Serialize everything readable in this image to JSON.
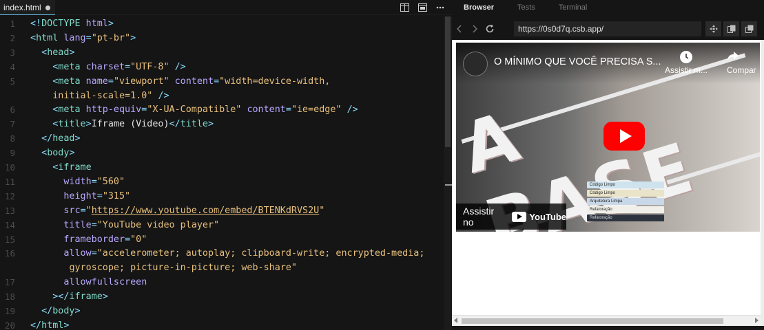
{
  "editor": {
    "tab": {
      "filename": "index.html",
      "unsaved": true
    },
    "actions": [
      "split-icon",
      "preview-icon",
      "more-icon"
    ],
    "lines": [
      {
        "n": "1",
        "html": "<span class=\"t\">&lt;!</span><span class=\"tn\">DOCTYPE</span> <span class=\"a\">html</span><span class=\"t\">&gt;</span>"
      },
      {
        "n": "2",
        "html": "<span class=\"t\">&lt;</span><span class=\"tn\">html</span> <span class=\"a\">lang</span><span class=\"t\">=</span><span class=\"v\">\"pt-br\"</span><span class=\"t\">&gt;</span>"
      },
      {
        "n": "3",
        "html": "  <span class=\"t\">&lt;</span><span class=\"tn\">head</span><span class=\"t\">&gt;</span>"
      },
      {
        "n": "4",
        "html": "    <span class=\"t\">&lt;</span><span class=\"tn\">meta</span> <span class=\"a\">charset</span><span class=\"t\">=</span><span class=\"v\">\"UTF-8\"</span> <span class=\"t\">/&gt;</span>"
      },
      {
        "n": "5",
        "html": "    <span class=\"t\">&lt;</span><span class=\"tn\">meta</span> <span class=\"a\">name</span><span class=\"t\">=</span><span class=\"v\">\"viewport\"</span> <span class=\"a\">content</span><span class=\"t\">=</span><span class=\"v\">\"width=device-width,</span>"
      },
      {
        "n": "",
        "html": "    <span class=\"v\">initial-scale=1.0\"</span> <span class=\"t\">/&gt;</span>"
      },
      {
        "n": "6",
        "html": "    <span class=\"t\">&lt;</span><span class=\"tn\">meta</span> <span class=\"a\">http-equiv</span><span class=\"t\">=</span><span class=\"v\">\"X-UA-Compatible\"</span> <span class=\"a\">content</span><span class=\"t\">=</span><span class=\"v\">\"ie=edge\"</span> <span class=\"t\">/&gt;</span>"
      },
      {
        "n": "7",
        "html": "    <span class=\"t\">&lt;</span><span class=\"tn\">title</span><span class=\"t\">&gt;</span><span class=\"p\">Iframe (Video)</span><span class=\"t\">&lt;/</span><span class=\"tn\">title</span><span class=\"t\">&gt;</span>"
      },
      {
        "n": "8",
        "html": "  <span class=\"t\">&lt;/</span><span class=\"tn\">head</span><span class=\"t\">&gt;</span>"
      },
      {
        "n": "9",
        "html": "  <span class=\"t\">&lt;</span><span class=\"tn\">body</span><span class=\"t\">&gt;</span>"
      },
      {
        "n": "10",
        "html": "    <span class=\"t\">&lt;</span><span class=\"tn\">iframe</span>"
      },
      {
        "n": "11",
        "html": "      <span class=\"a\">width</span><span class=\"t\">=</span><span class=\"v\">\"560\"</span>"
      },
      {
        "n": "12",
        "html": "      <span class=\"a\">height</span><span class=\"t\">=</span><span class=\"v\">\"315\"</span>"
      },
      {
        "n": "13",
        "html": "      <span class=\"a\">src</span><span class=\"t\">=</span><span class=\"v\">\"</span><span class=\"u\">https://www.youtube.com/embed/BTENKdRVS2U</span><span class=\"v\">\"</span>"
      },
      {
        "n": "14",
        "html": "      <span class=\"a\">title</span><span class=\"t\">=</span><span class=\"v\">\"YouTube video player\"</span>"
      },
      {
        "n": "15",
        "html": "      <span class=\"a\">frameborder</span><span class=\"t\">=</span><span class=\"v\">\"0\"</span>"
      },
      {
        "n": "16",
        "html": "      <span class=\"a\">allow</span><span class=\"t\">=</span><span class=\"v\">\"accelerometer; autoplay; clipboard-write; encrypted-media;</span>"
      },
      {
        "n": "",
        "html": "       <span class=\"v\">gyroscope; picture-in-picture; web-share\"</span>"
      },
      {
        "n": "17",
        "html": "      <span class=\"a\">allowfullscreen</span>"
      },
      {
        "n": "18",
        "html": "    <span class=\"t\">&gt;&lt;/</span><span class=\"tn\">iframe</span><span class=\"t\">&gt;</span>"
      },
      {
        "n": "19",
        "html": "  <span class=\"t\">&lt;/</span><span class=\"tn\">body</span><span class=\"t\">&gt;</span>"
      },
      {
        "n": "20",
        "html": "<span class=\"t\">&lt;/</span><span class=\"tn\">html</span><span class=\"t\">&gt;</span>"
      }
    ]
  },
  "preview": {
    "tabs": [
      {
        "label": "Browser",
        "active": true
      },
      {
        "label": "Tests",
        "active": false
      },
      {
        "label": "Terminal",
        "active": false
      }
    ],
    "nav": {
      "back_icon": "arrow-left-icon",
      "forward_icon": "arrow-right-icon",
      "reload_icon": "reload-icon",
      "url": "https://0s0d7q.csb.app/",
      "icons": [
        "move-icon",
        "split-icon",
        "open-new-window-icon"
      ]
    },
    "video": {
      "title": "O MÍNIMO QUE VOCÊ PRECISA S...",
      "watch_later_label": "Assistir m...",
      "share_label": "Compar",
      "overlay_text": "A BASE",
      "watch_on_label": "Assistir no",
      "youtube_word": "YouTube",
      "books": [
        "Código Limpo",
        "Código Limpo",
        "Arquitetura Limpa",
        "Refatoração",
        "Refatoração"
      ],
      "play_color": "#ff0000"
    }
  }
}
